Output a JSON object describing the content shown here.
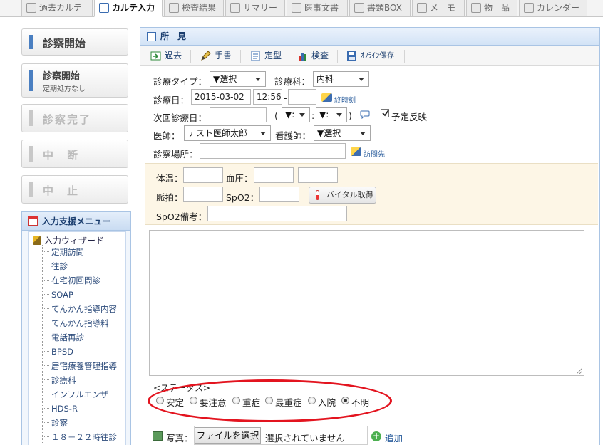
{
  "tabs": [
    {
      "label": "過去カルテ",
      "active": false,
      "icon": "document-icon"
    },
    {
      "label": "カルテ入力",
      "active": true,
      "icon": "edit-icon"
    },
    {
      "label": "検査結果",
      "active": false,
      "icon": "lab-icon"
    },
    {
      "label": "サマリー",
      "active": false,
      "icon": "summary-icon"
    },
    {
      "label": "医事文書",
      "active": false,
      "icon": "pdf-icon"
    },
    {
      "label": "書類BOX",
      "active": false,
      "icon": "box-icon"
    },
    {
      "label": "メ　モ",
      "active": false,
      "icon": "memo-icon"
    },
    {
      "label": "物　品",
      "active": false,
      "icon": "goods-icon"
    },
    {
      "label": "カレンダー",
      "active": false,
      "icon": "calendar-icon"
    }
  ],
  "sidebar": {
    "buttons": [
      {
        "label": "診察開始",
        "sub": "",
        "enabled": true
      },
      {
        "label": "診察開始",
        "sub": "定期処方なし",
        "enabled": true
      },
      {
        "label": "診察完了",
        "sub": "",
        "enabled": false
      },
      {
        "label": "中　断",
        "sub": "",
        "enabled": false
      },
      {
        "label": "中　止",
        "sub": "",
        "enabled": false
      }
    ],
    "menu_title": "入力支援メニュー",
    "wizard_label": "入力ウィザード",
    "items": [
      "定期訪問",
      "往診",
      "在宅初回問診",
      "SOAP",
      "てんかん指導内容",
      "てんかん指導料",
      "電話再診",
      "BPSD",
      "居宅療養管理指導",
      "診療科",
      "インフルエンザ",
      "HDS-R",
      "診察",
      "１８－２２時往診"
    ]
  },
  "main": {
    "title": "所　見",
    "toolbar": [
      {
        "label": "過去",
        "icon": "import-icon"
      },
      {
        "label": "手書",
        "icon": "pen-icon"
      },
      {
        "label": "定型",
        "icon": "template-icon"
      },
      {
        "label": "検査",
        "icon": "chart-icon"
      },
      {
        "label": "ｵﾌﾗｲﾝ保存",
        "icon": "save-icon"
      }
    ],
    "form": {
      "visit_type_label": "診療タイプ：",
      "visit_type_value": "▼選択",
      "dept_label": "診療科：",
      "dept_value": "内科",
      "date_label": "診療日：",
      "date_value": "2015-03-02",
      "time_value": "12:56",
      "time_dash": "-",
      "time_end_value": "",
      "end_time_link": "終時刻",
      "next_date_label": "次回診療日：",
      "next_date_value": "",
      "next_hour_value": "▼:",
      "next_min_value": "▼:",
      "paren_open": "(",
      "paren_close": ")",
      "colon": ":",
      "plan_reflect_label": "予定反映",
      "plan_reflect_checked": true,
      "doctor_label": "医師：",
      "doctor_value": "テスト医師太郎",
      "nurse_label": "看護師：",
      "nurse_value": "▼選択",
      "place_label": "診察場所：",
      "place_value": "",
      "place_link": "訪問先"
    },
    "vitals": {
      "temp_label": "体温：",
      "bp_label": "血圧：",
      "bp_dash": "-",
      "pulse_label": "脈拍：",
      "spo2_label": "SpO2：",
      "vital_button": "バイタル取得",
      "spo2_note_label": "SpO2備考："
    },
    "notes_value": "",
    "status": {
      "label": "<ステータス>",
      "options": [
        "安定",
        "要注意",
        "重症",
        "最重症",
        "入院",
        "不明"
      ],
      "selected": "不明",
      "highlight_color": "#e3141f"
    },
    "photo": {
      "label": "写真：",
      "file_button": "ファイルを選択",
      "file_status": "選択されていません",
      "add_label": "追加"
    }
  }
}
